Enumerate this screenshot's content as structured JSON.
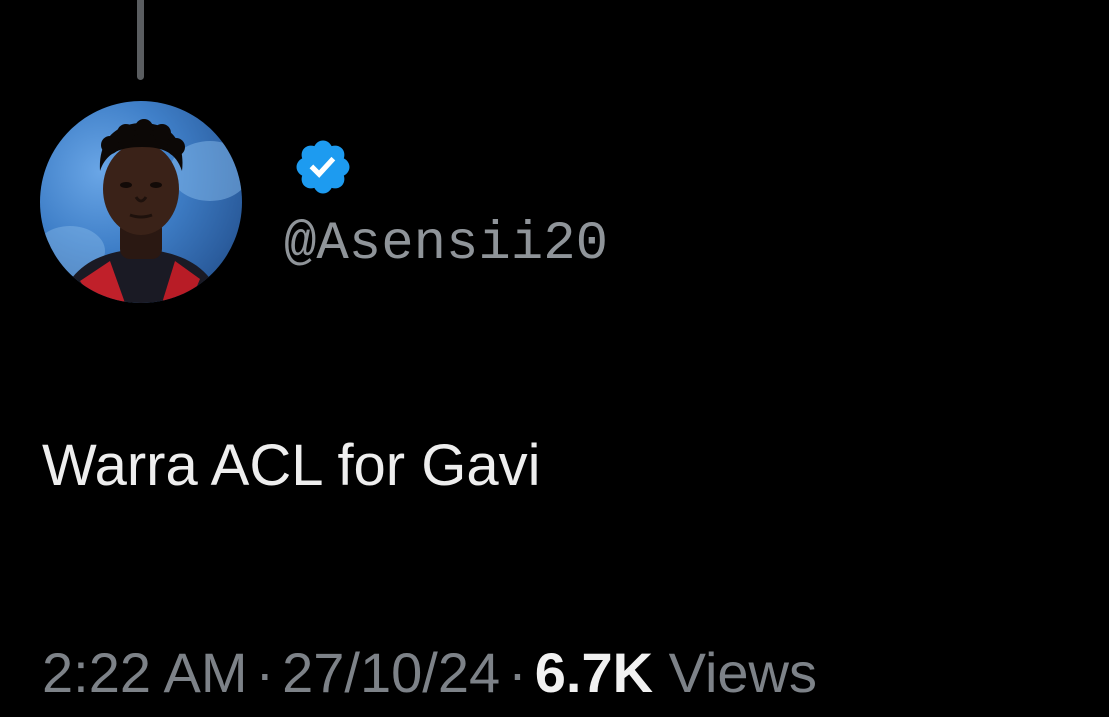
{
  "tweet": {
    "handle": "@Asensii20",
    "verified": true,
    "text": "Warra ACL for Gavi",
    "time": "2:22 AM",
    "date": "27/10/24",
    "separator": "·",
    "views_count": "6.7K",
    "views_label": "Views"
  },
  "icons": {
    "verified": "verified-badge-icon",
    "avatar": "avatar-image"
  },
  "colors": {
    "background": "#000000",
    "verified_blue": "#1d9bf0",
    "secondary_text": "#7d8288",
    "primary_text": "#e7e9ea"
  }
}
